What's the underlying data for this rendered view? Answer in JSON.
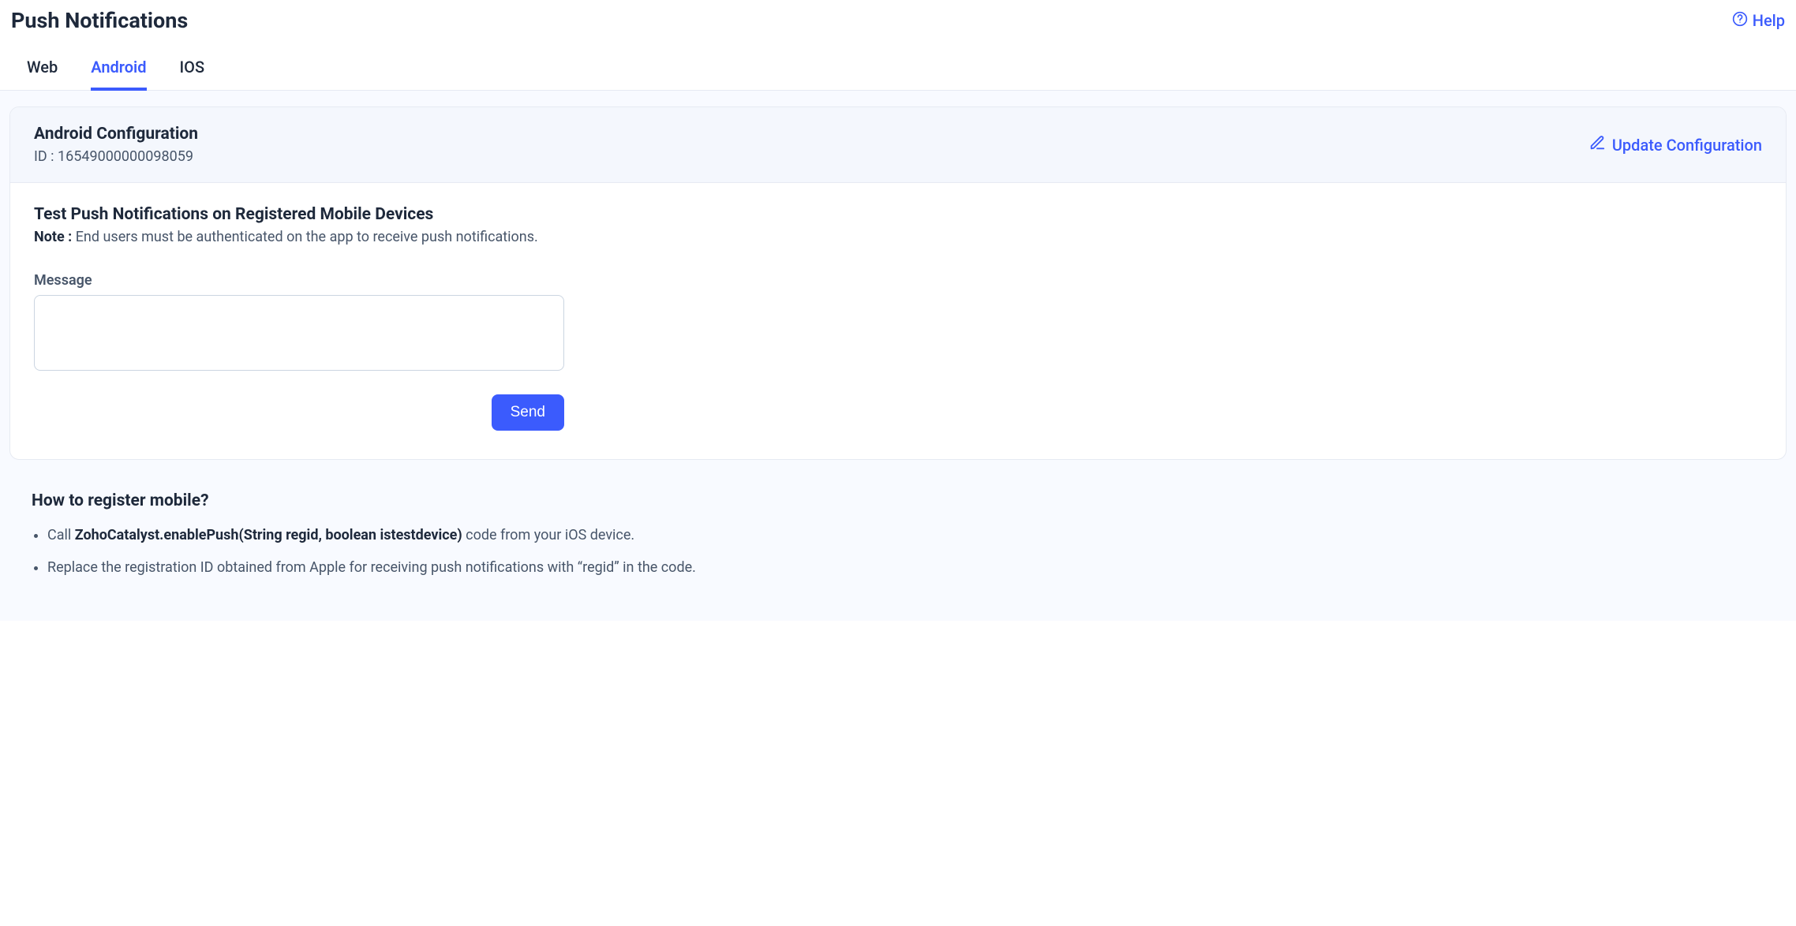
{
  "header": {
    "title": "Push Notifications",
    "help_label": "Help"
  },
  "tabs": [
    {
      "label": "Web",
      "active": false
    },
    {
      "label": "Android",
      "active": true
    },
    {
      "label": "IOS",
      "active": false
    }
  ],
  "config": {
    "title": "Android Configuration",
    "id_line": "ID : 16549000000098059",
    "update_label": "Update Configuration"
  },
  "test_section": {
    "heading": "Test Push Notifications on Registered Mobile Devices",
    "note_label": "Note :",
    "note_text": "End users must be authenticated on the app to receive push notifications.",
    "message_label": "Message",
    "message_value": "",
    "send_label": "Send"
  },
  "howto": {
    "heading": "How to register mobile?",
    "items": [
      {
        "prefix": "Call ",
        "strong": "ZohoCatalyst.enablePush(String regid, boolean istestdevice)",
        "suffix": " code from your iOS device."
      },
      {
        "prefix": "",
        "strong": "",
        "suffix": "Replace the registration ID obtained from Apple for receiving push notifications with “regid” in the code."
      }
    ]
  }
}
